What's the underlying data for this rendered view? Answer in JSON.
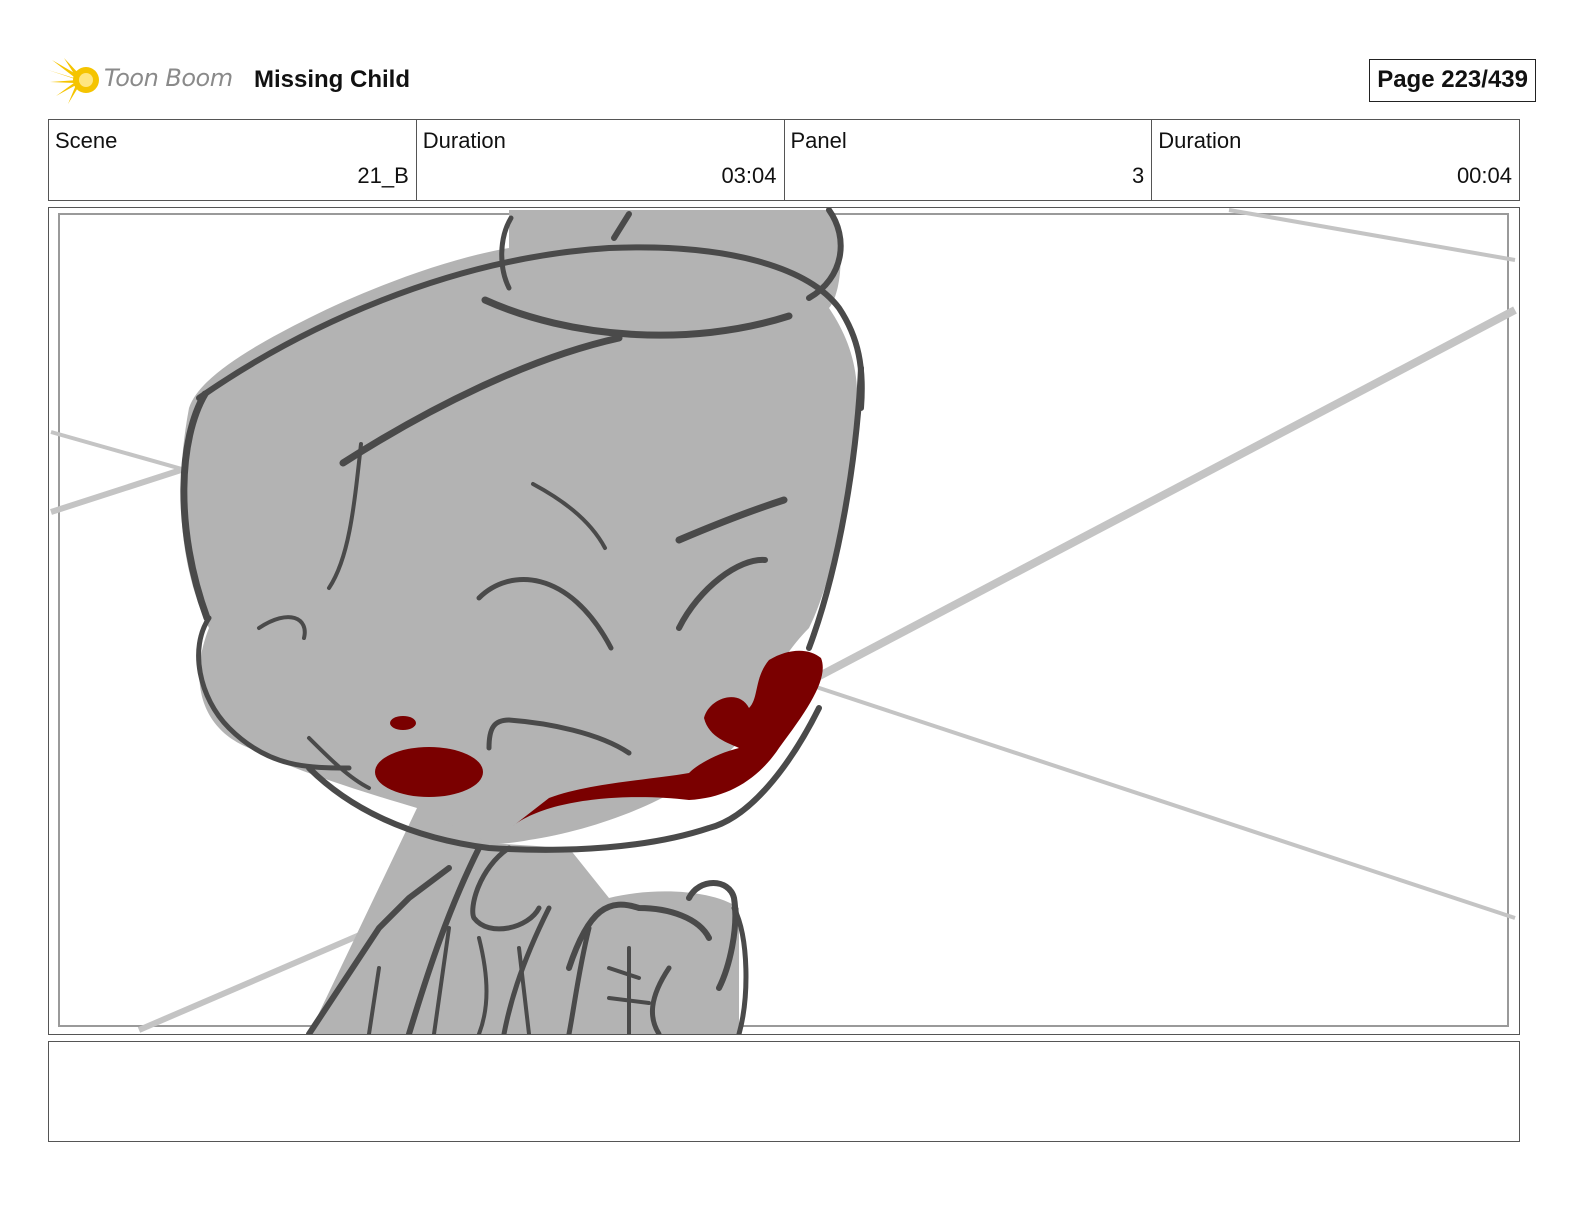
{
  "header": {
    "logo_text": "Toon Boom",
    "project_title": "Missing Child",
    "page_label": "Page 223/439"
  },
  "info": {
    "scene_label": "Scene",
    "scene_value": "21_B",
    "scene_duration_label": "Duration",
    "scene_duration_value": "03:04",
    "panel_label": "Panel",
    "panel_value": "3",
    "panel_duration_label": "Duration",
    "panel_duration_value": "00:04"
  },
  "notes": {
    "text": ""
  },
  "colors": {
    "logo_yellow": "#f5c400",
    "skin_gray": "#b3b3b3",
    "line_dark": "#4a4a4a",
    "blood_red": "#7a0000",
    "perspective_gray": "#c4c4c4"
  }
}
